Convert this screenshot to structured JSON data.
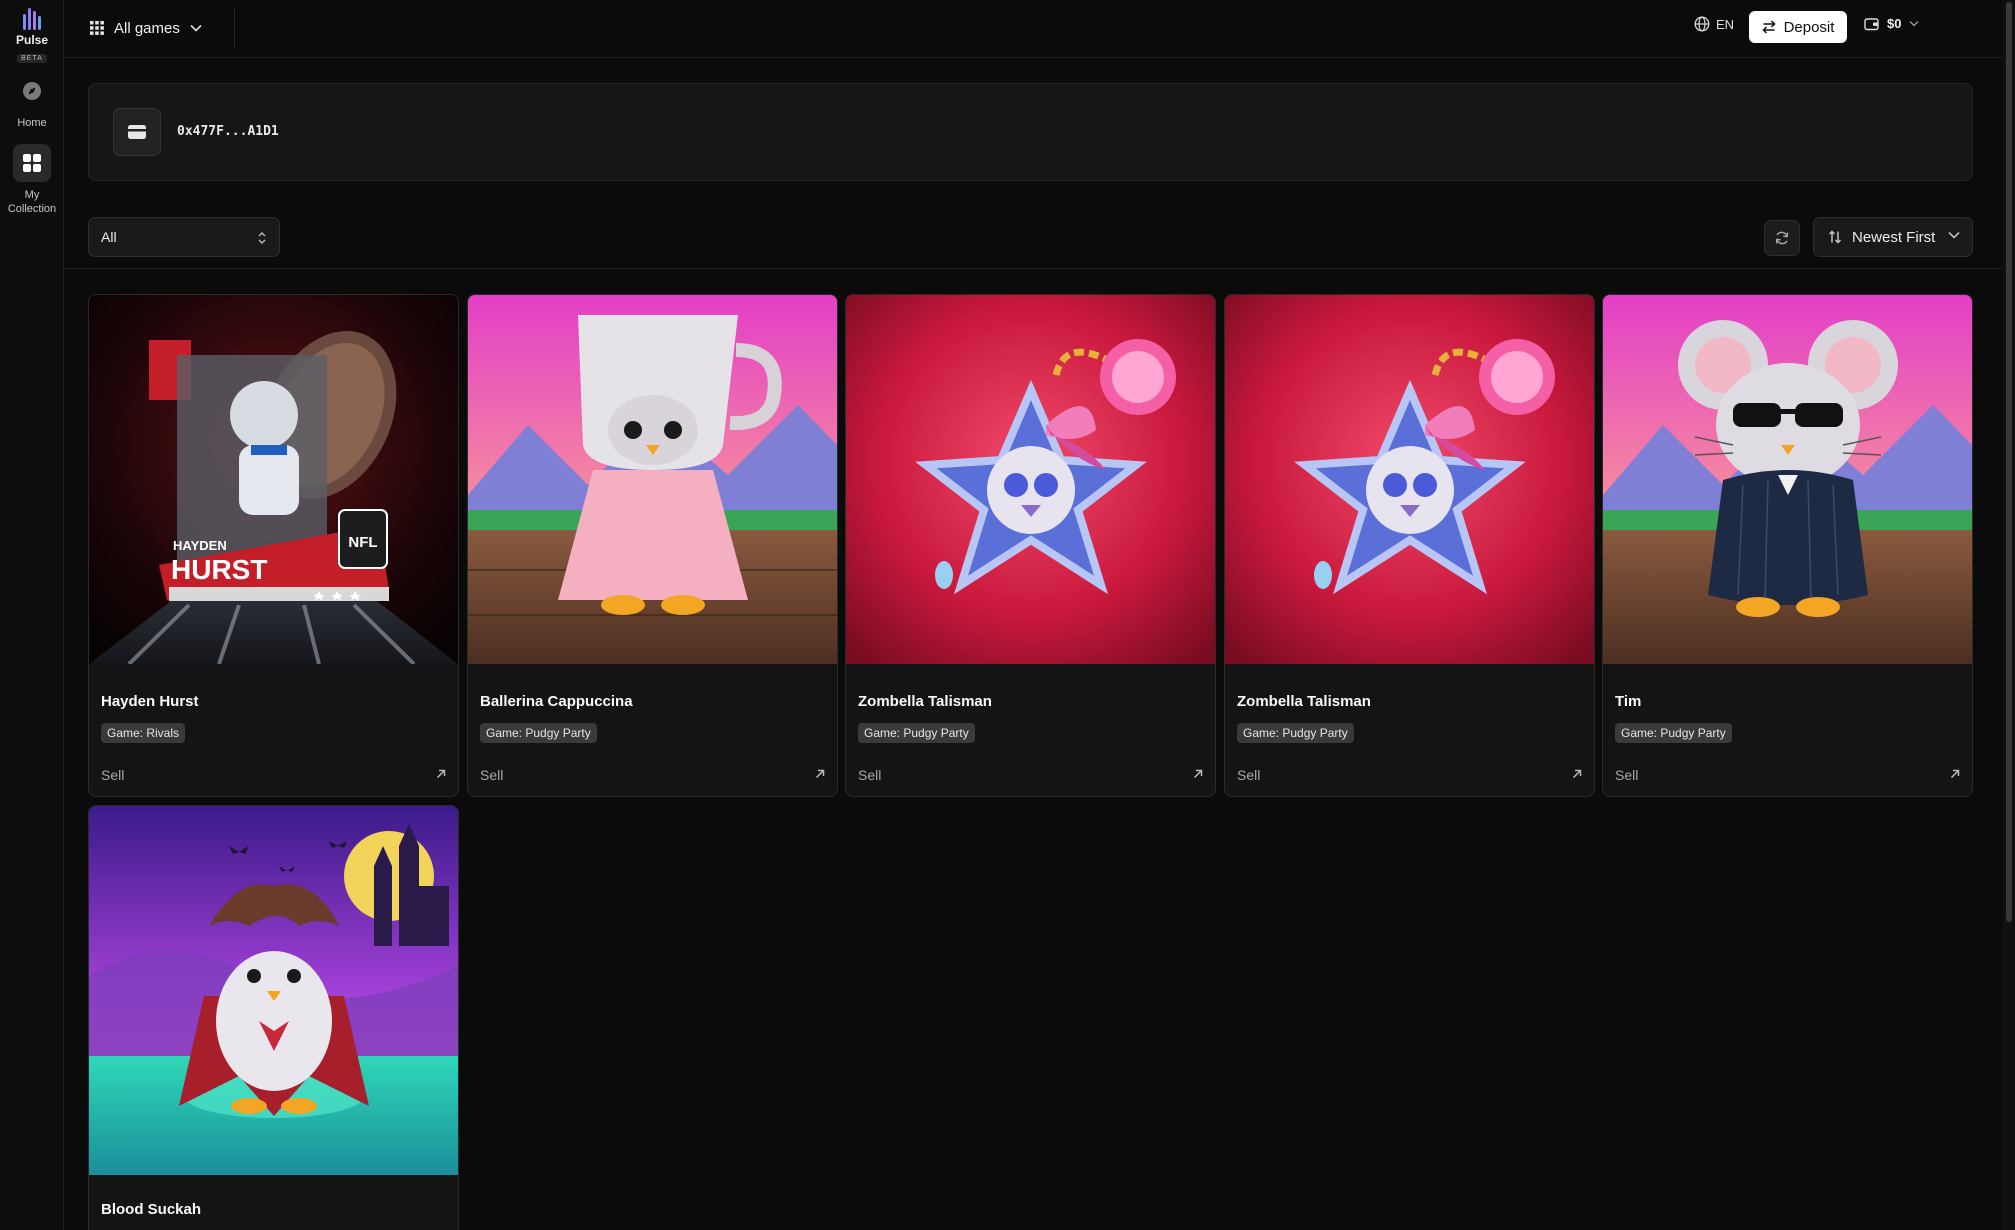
{
  "sidebar": {
    "logo_name": "Pulse",
    "logo_badge": "BETA",
    "items": [
      {
        "label": "Home",
        "icon": "compass-icon",
        "active": false
      },
      {
        "label": "My Collection",
        "icon": "grid-icon",
        "active": true
      }
    ]
  },
  "topbar": {
    "games_label": "All games",
    "language": "EN",
    "deposit_label": "Deposit",
    "balance": "$0"
  },
  "wallet": {
    "address": "0x477F...A1D1"
  },
  "filters": {
    "game_filter": "All",
    "sort_label": "Newest First"
  },
  "cards": [
    {
      "name": "Hayden Hurst",
      "game": "Game: Rivals",
      "action": "Sell"
    },
    {
      "name": "Ballerina Cappuccina",
      "game": "Game: Pudgy Party",
      "action": "Sell"
    },
    {
      "name": "Zombella Talisman",
      "game": "Game: Pudgy Party",
      "action": "Sell"
    },
    {
      "name": "Zombella Talisman",
      "game": "Game: Pudgy Party",
      "action": "Sell"
    },
    {
      "name": "Tim",
      "game": "Game: Pudgy Party",
      "action": "Sell"
    },
    {
      "name": "Blood Suckah",
      "game": "",
      "action": ""
    }
  ],
  "card_art_text": {
    "player_first": "HAYDEN",
    "player_last": "HURST",
    "league": "NFL"
  },
  "colors": {
    "background": "#0b0b0b",
    "card": "#141414",
    "deposit_button": "#ffffff",
    "badge": "#3a3a3a"
  }
}
